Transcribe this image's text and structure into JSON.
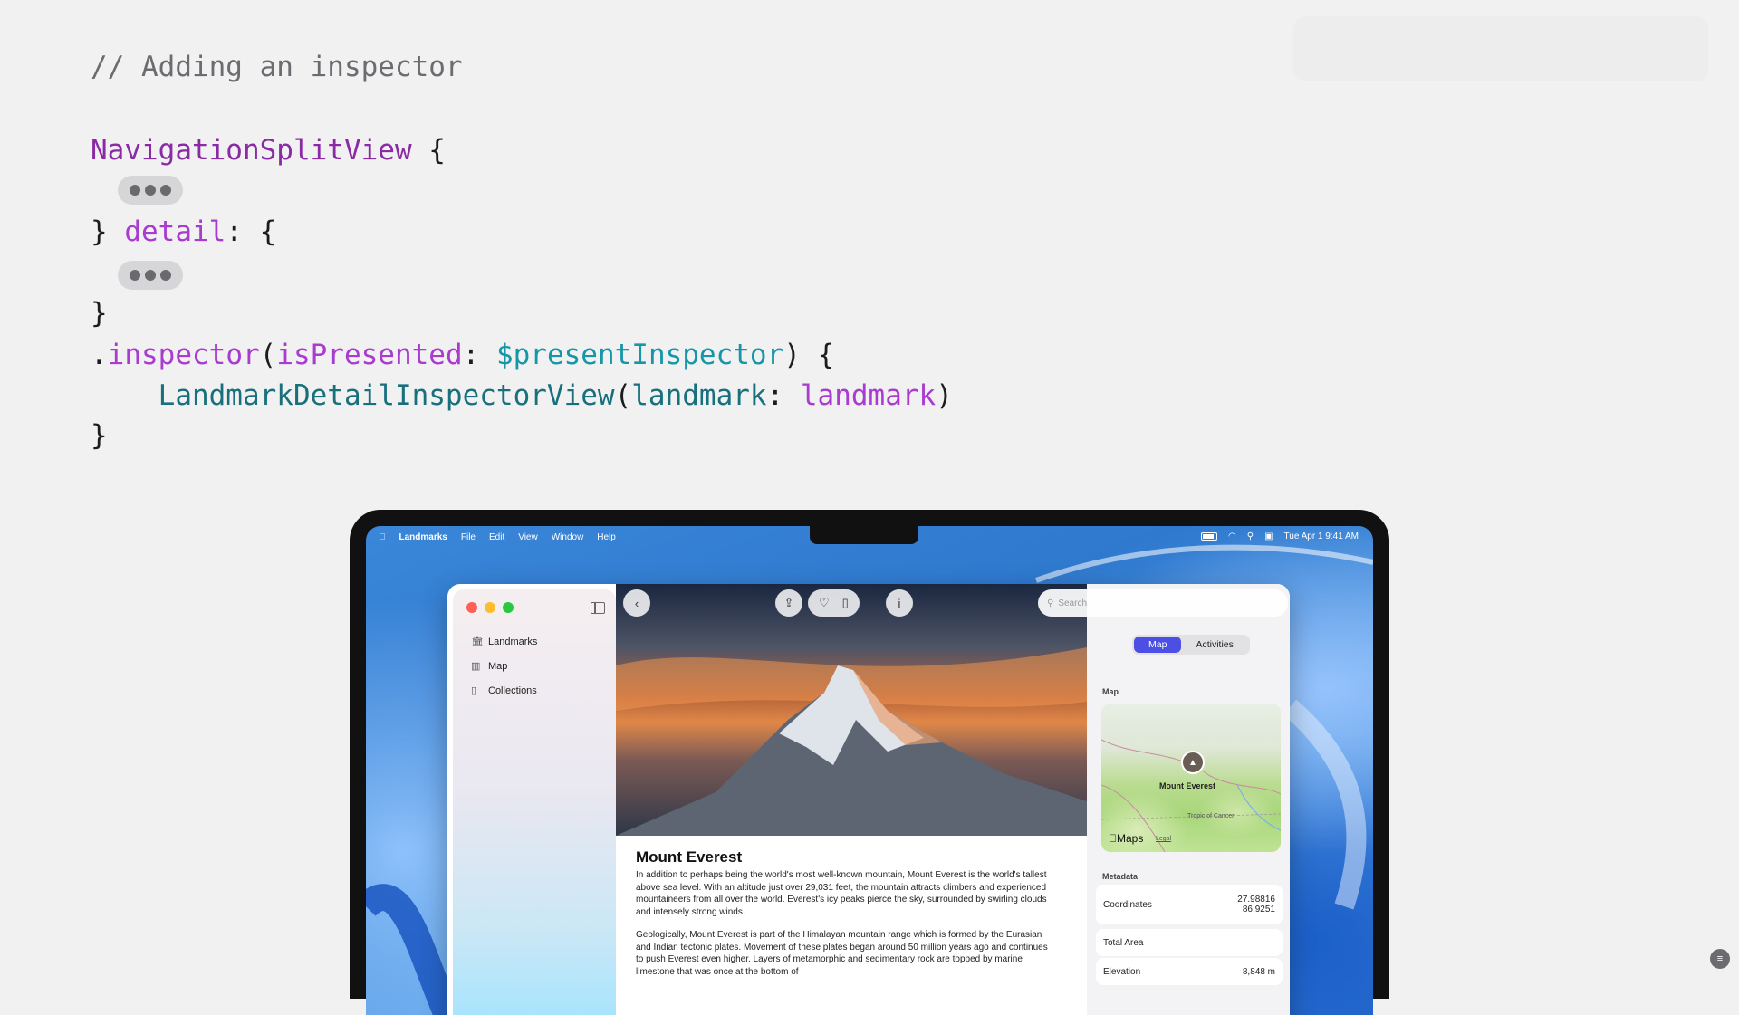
{
  "code": {
    "comment": "// Adding an inspector",
    "l2_type": "NavigationSplitView",
    "l2_brace": " {",
    "l4_close": "} ",
    "l4_label": "detail",
    "l4_rest": ": {",
    "l6_close": "}",
    "l7_dot": ".",
    "l7_method": "inspector",
    "l7_paren": "(",
    "l7_arg": "isPresented",
    "l7_colon": ": ",
    "l7_binding": "$presentInspector",
    "l7_end": ") {",
    "l8_indent": "    ",
    "l8_type": "LandmarkDetailInspectorView",
    "l8_paren": "(",
    "l8_arg": "landmark",
    "l8_colon": ": ",
    "l8_value": "landmark",
    "l8_end": ")",
    "l9_close": "}"
  },
  "menubar": {
    "app_name": "Landmarks",
    "items": [
      "File",
      "Edit",
      "View",
      "Window",
      "Help"
    ],
    "datetime": "Tue Apr 1  9:41 AM"
  },
  "sidebar": {
    "items": [
      {
        "label": "Landmarks",
        "icon": "building-columns-icon"
      },
      {
        "label": "Map",
        "icon": "map-icon"
      },
      {
        "label": "Collections",
        "icon": "book-icon"
      }
    ]
  },
  "toolbar": {
    "back_icon": "chevron-left-icon",
    "share_icon": "share-icon",
    "favorite_icon": "heart-icon",
    "collection_icon": "collection-icon",
    "info_icon": "info-icon"
  },
  "detail": {
    "title": "Mount Everest",
    "p1": "In addition to perhaps being the world's most well-known mountain, Mount Everest is the world's tallest above sea level. With an altitude just over 29,031 feet, the mountain attracts climbers and experienced mountaineers from all over the world. Everest's icy peaks pierce the sky, surrounded by swirling clouds and intensely strong winds.",
    "p2": "Geologically, Mount Everest is part of the Himalayan mountain range which is formed by the Eurasian and Indian tectonic plates. Movement of these plates began around 50 million years ago and continues to push Everest even higher. Layers of metamorphic and sedimentary rock are topped by marine limestone that was once at the bottom of"
  },
  "inspector": {
    "search_placeholder": "Search",
    "segments": [
      "Map",
      "Activities"
    ],
    "selected_segment": "Map",
    "map_section": "Map",
    "map_label": "Mount Everest",
    "map_tropic": "Tropic of Cancer",
    "maps_brand": "Maps",
    "maps_legal": "Legal",
    "metadata_section": "Metadata",
    "coordinates_label": "Coordinates",
    "coordinates_lat": "27.98816",
    "coordinates_lon": "86.9251",
    "total_area_label": "Total Area",
    "elevation_label": "Elevation",
    "elevation_value": "8,848 m"
  },
  "colors": {
    "accent": "#4b4fe3",
    "code_keyword": "#8a2aa5",
    "code_purple": "#a93bd0",
    "code_teal": "#1597a8"
  }
}
